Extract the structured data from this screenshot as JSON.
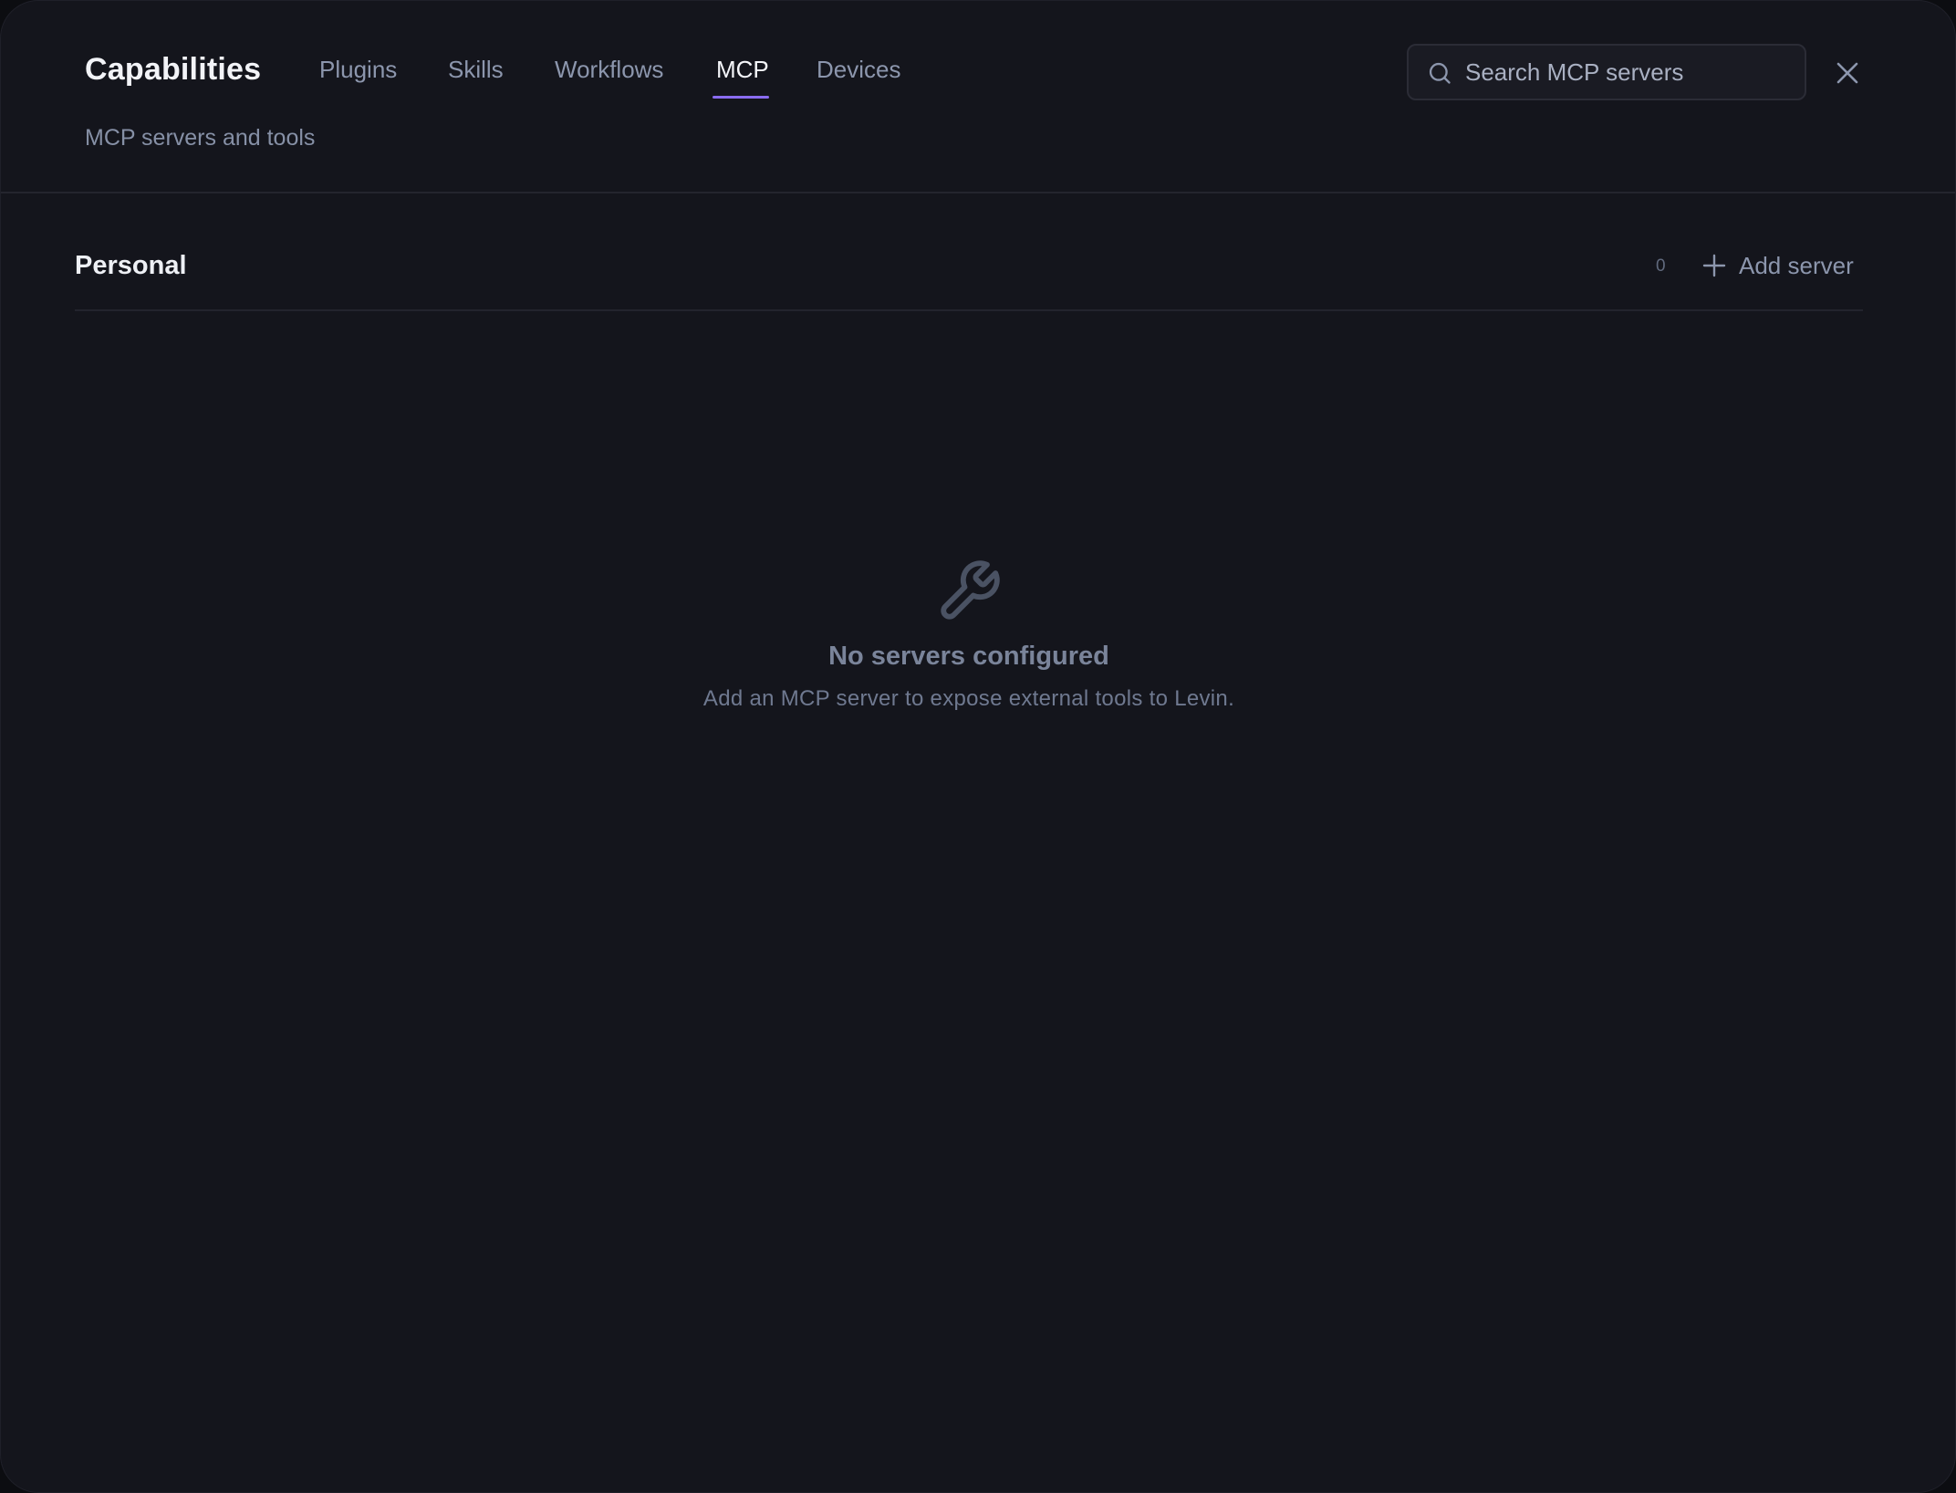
{
  "header": {
    "title": "Capabilities",
    "subtitle": "MCP servers and tools",
    "tabs": [
      {
        "label": "Plugins"
      },
      {
        "label": "Skills"
      },
      {
        "label": "Workflows"
      },
      {
        "label": "MCP"
      },
      {
        "label": "Devices"
      }
    ],
    "active_tab": "MCP",
    "search": {
      "placeholder": "Search MCP servers",
      "value": ""
    },
    "close_icon": "close-icon"
  },
  "section": {
    "title": "Personal",
    "count": "0",
    "add_label": "Add server"
  },
  "empty_state": {
    "icon": "wrench-icon",
    "title": "No servers configured",
    "description": "Add an MCP server to expose external tools to Levin."
  },
  "colors": {
    "background": "#14151c",
    "accent": "#8a6cf0",
    "muted_text": "#8c96ad"
  }
}
